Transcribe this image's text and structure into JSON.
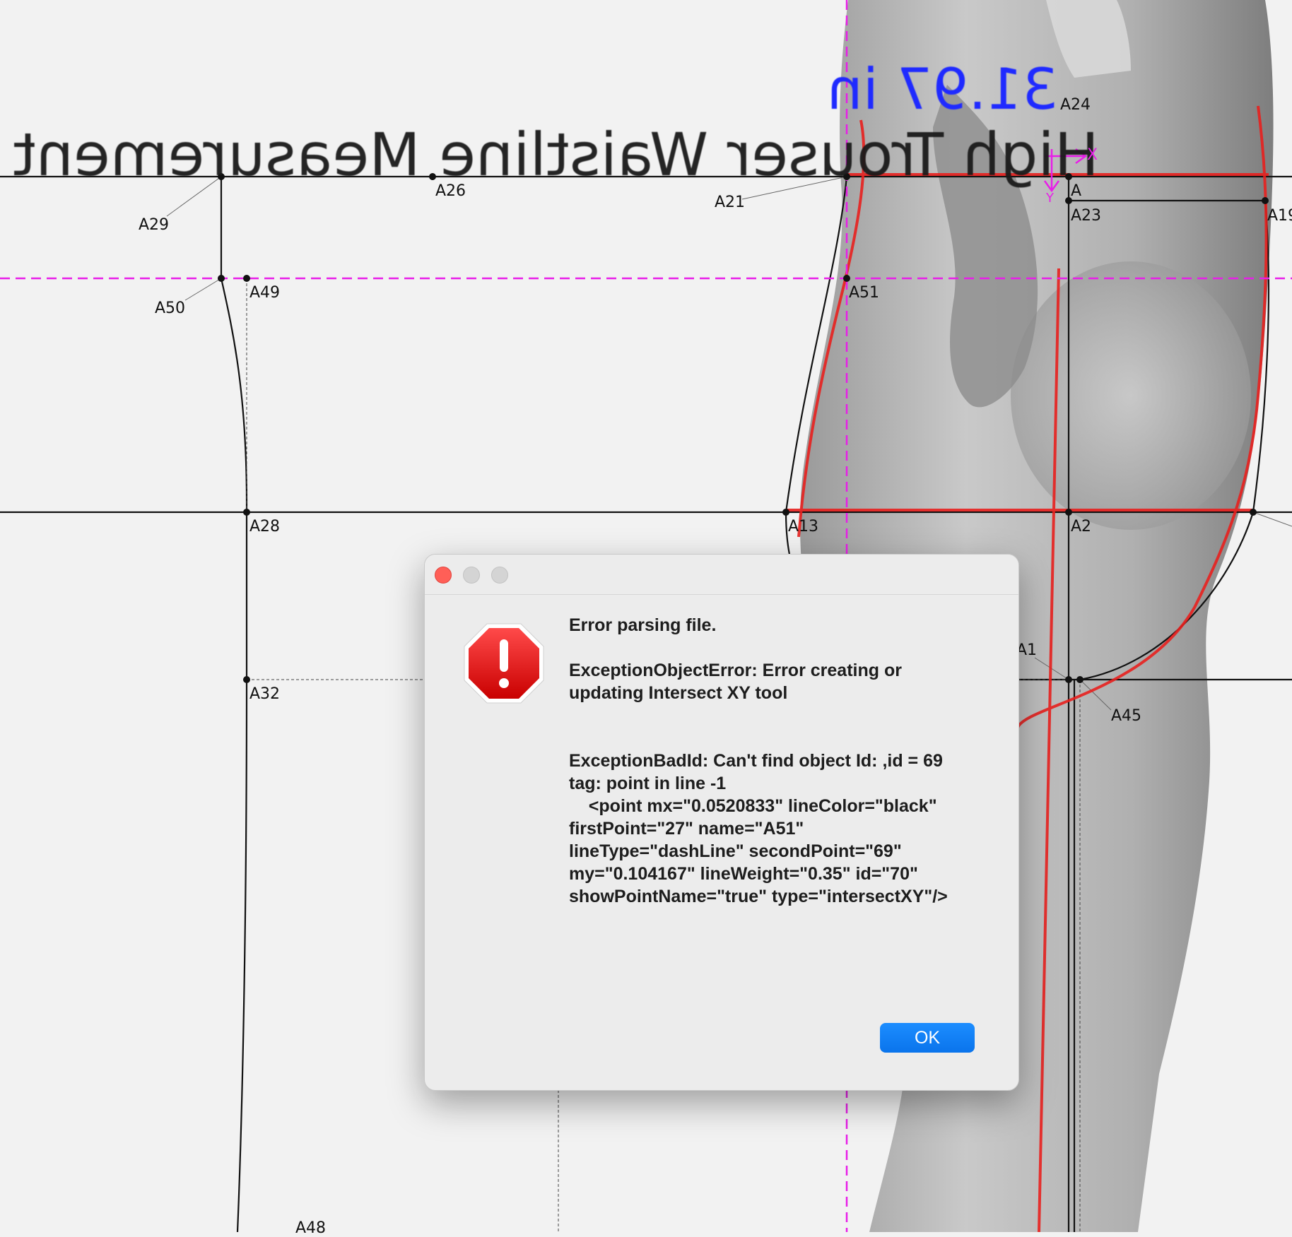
{
  "canvas": {
    "measurement_title": "High Trouser Waistline Measurement",
    "dim_top": "31.97 in",
    "axis_x": "X",
    "axis_y": "Y",
    "points": [
      {
        "name": "A29"
      },
      {
        "name": "A26"
      },
      {
        "name": "A21"
      },
      {
        "name": "A24"
      },
      {
        "name": "A"
      },
      {
        "name": "A23"
      },
      {
        "name": "A19"
      },
      {
        "name": "A50"
      },
      {
        "name": "A49"
      },
      {
        "name": "A51"
      },
      {
        "name": "A28"
      },
      {
        "name": "A13"
      },
      {
        "name": "A2"
      },
      {
        "name": "A1"
      },
      {
        "name": "A45"
      },
      {
        "name": "A32"
      },
      {
        "name": "A48"
      }
    ],
    "colors": {
      "guide": "#e81ee8",
      "curve": "#e8201e",
      "dimension": "#1f2aff",
      "line": "#111111"
    }
  },
  "dialog": {
    "traffic_lights": [
      "close",
      "minimize",
      "zoom"
    ],
    "icon": "stop-alert-icon",
    "title": "Error parsing file.",
    "error1": "ExceptionObjectError: Error creating or updating Intersect XY tool",
    "error2": "ExceptionBadId: Can't find object Id: ,id = 69\ntag: point in line -1\n    <point mx=\"0.0520833\" lineColor=\"black\" firstPoint=\"27\" name=\"A51\" lineType=\"dashLine\" secondPoint=\"69\" my=\"0.104167\" lineWeight=\"0.35\" id=\"70\" showPointName=\"true\" type=\"intersectXY\"/>",
    "ok_label": "OK",
    "accent": "#0a74ec"
  }
}
